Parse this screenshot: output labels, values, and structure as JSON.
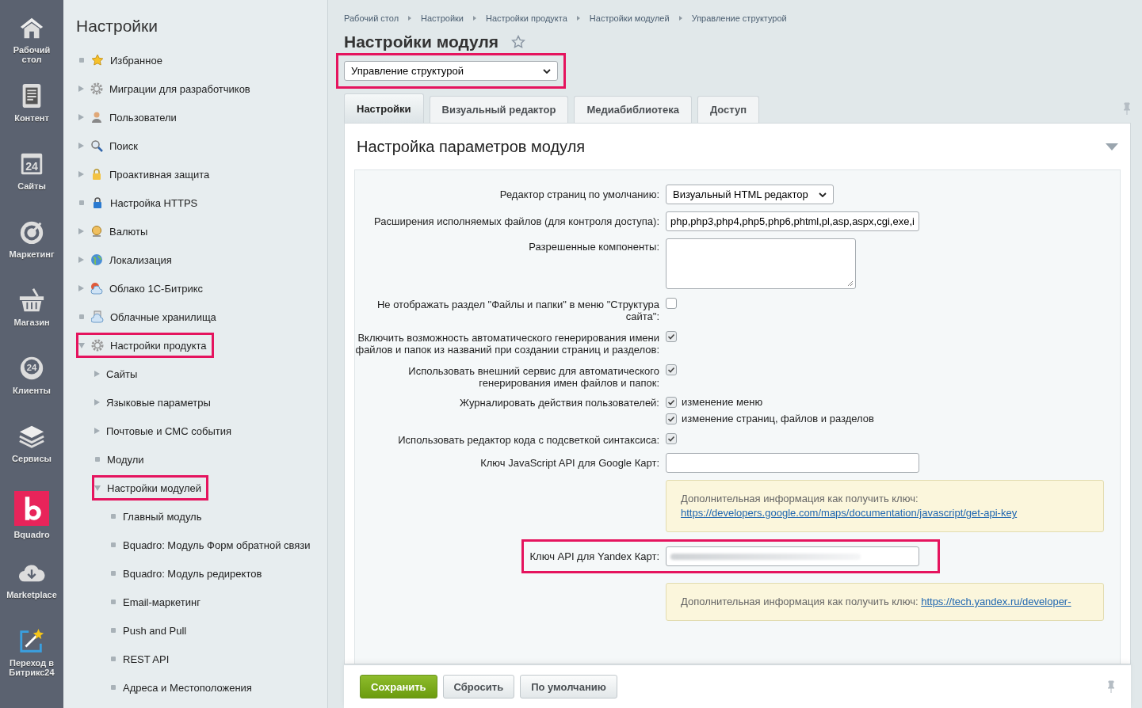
{
  "rail": [
    {
      "label": "Рабочий стол"
    },
    {
      "label": "Контент"
    },
    {
      "label": "Сайты",
      "icon_text": "24"
    },
    {
      "label": "Маркетинг"
    },
    {
      "label": "Магазин"
    },
    {
      "label": "Клиенты",
      "icon_text": "24"
    },
    {
      "label": "Сервисы"
    },
    {
      "label": "Bquadro"
    },
    {
      "label": "Marketplace"
    },
    {
      "label": "Переход в Битрикс24"
    }
  ],
  "menu": {
    "title": "Настройки",
    "items": [
      {
        "label": "Избранное",
        "kind": "leaf",
        "highlighted": false
      },
      {
        "label": "Миграции для разработчиков",
        "kind": "branch",
        "expanded": false,
        "highlighted": false
      },
      {
        "label": "Пользователи",
        "kind": "branch",
        "expanded": false,
        "highlighted": false
      },
      {
        "label": "Поиск",
        "kind": "branch",
        "expanded": false,
        "highlighted": false
      },
      {
        "label": "Проактивная защита",
        "kind": "branch",
        "expanded": false,
        "highlighted": false
      },
      {
        "label": "Настройка HTTPS",
        "kind": "leaf",
        "highlighted": false
      },
      {
        "label": "Валюты",
        "kind": "branch",
        "expanded": false,
        "highlighted": false
      },
      {
        "label": "Локализация",
        "kind": "branch",
        "expanded": false,
        "highlighted": false
      },
      {
        "label": "Облако 1С-Битрикс",
        "kind": "branch",
        "expanded": false,
        "highlighted": false
      },
      {
        "label": "Облачные хранилища",
        "kind": "leaf",
        "highlighted": false
      },
      {
        "label": "Настройки продукта",
        "kind": "branch",
        "expanded": true,
        "highlighted": true,
        "children": [
          {
            "label": "Сайты",
            "kind": "branch",
            "expanded": false,
            "highlighted": false
          },
          {
            "label": "Языковые параметры",
            "kind": "branch",
            "expanded": false,
            "highlighted": false
          },
          {
            "label": "Почтовые и СМС события",
            "kind": "branch",
            "expanded": false,
            "highlighted": false
          },
          {
            "label": "Модули",
            "kind": "leaf",
            "highlighted": false
          },
          {
            "label": "Настройки модулей",
            "kind": "branch",
            "expanded": true,
            "highlighted": true,
            "children": [
              {
                "label": "Главный модуль",
                "kind": "leaf",
                "highlighted": false
              },
              {
                "label": "Bquadro: Модуль Форм обратной связи",
                "kind": "leaf",
                "highlighted": false
              },
              {
                "label": "Bquadro: Модуль редиректов",
                "kind": "leaf",
                "highlighted": false
              },
              {
                "label": "Email-маркетинг",
                "kind": "leaf",
                "highlighted": false
              },
              {
                "label": "Push and Pull",
                "kind": "leaf",
                "highlighted": false
              },
              {
                "label": "REST API",
                "kind": "leaf",
                "highlighted": false
              },
              {
                "label": "Адреса и Местоположения",
                "kind": "leaf",
                "highlighted": false
              }
            ]
          }
        ]
      }
    ]
  },
  "breadcrumbs": [
    "Рабочий стол",
    "Настройки",
    "Настройки продукта",
    "Настройки модулей",
    "Управление структурой"
  ],
  "page_title": "Настройки модуля",
  "module_select": {
    "value": "Управление структурой",
    "highlighted": true
  },
  "tabs": [
    {
      "label": "Настройки",
      "selected": true
    },
    {
      "label": "Визуальный редактор",
      "selected": false
    },
    {
      "label": "Медиабиблиотека",
      "selected": false
    },
    {
      "label": "Доступ",
      "selected": false
    }
  ],
  "section_title": "Настройка параметров модуля",
  "fields": [
    {
      "kind": "select",
      "label": "Редактор страниц по умолчанию:",
      "value": "Визуальный HTML редактор"
    },
    {
      "kind": "text",
      "label": "Расширения исполняемых файлов (для контроля доступа):",
      "value": "php,php3,php4,php5,php6,phtml,pl,asp,aspx,cgi,exe,i"
    },
    {
      "kind": "textarea",
      "label": "Разрешенные компоненты:"
    },
    {
      "kind": "checkbox",
      "label": "Не отображать раздел \"Файлы и папки\" в меню \"Структура сайта\":",
      "checked": false
    },
    {
      "kind": "checkbox",
      "label": "Включить возможность автоматического генерирования имени файлов и папок из названий при создании страниц и разделов:",
      "checked": true
    },
    {
      "kind": "checkbox",
      "label": "Использовать внешний сервис для автоматического генерирования имен файлов и папок:",
      "checked": true
    },
    {
      "kind": "checkbox_group",
      "label": "Журналировать действия пользователей:",
      "options": [
        {
          "label": "изменение меню",
          "checked": true
        },
        {
          "label": "изменение страниц, файлов и разделов",
          "checked": true
        }
      ]
    },
    {
      "kind": "checkbox",
      "label": "Использовать редактор кода с подсветкой синтаксиса:",
      "checked": true
    },
    {
      "kind": "text",
      "label": "Ключ JavaScript API для Google Карт:"
    },
    {
      "kind": "note",
      "text": "Дополнительная информация как получить ключ:",
      "link": "https://developers.google.com/maps/documentation/javascript/get-api-key"
    },
    {
      "kind": "redacted",
      "label": "Ключ API для Yandex Карт:",
      "highlighted": true
    },
    {
      "kind": "note",
      "text": "Дополнительная информация как получить ключ:",
      "link": "https://tech.yandex.ru/developer-"
    }
  ],
  "buttons": [
    {
      "label": "Сохранить",
      "kind": "primary"
    },
    {
      "label": "Сбросить",
      "kind": "secondary"
    },
    {
      "label": "По умолчанию",
      "kind": "secondary"
    }
  ]
}
